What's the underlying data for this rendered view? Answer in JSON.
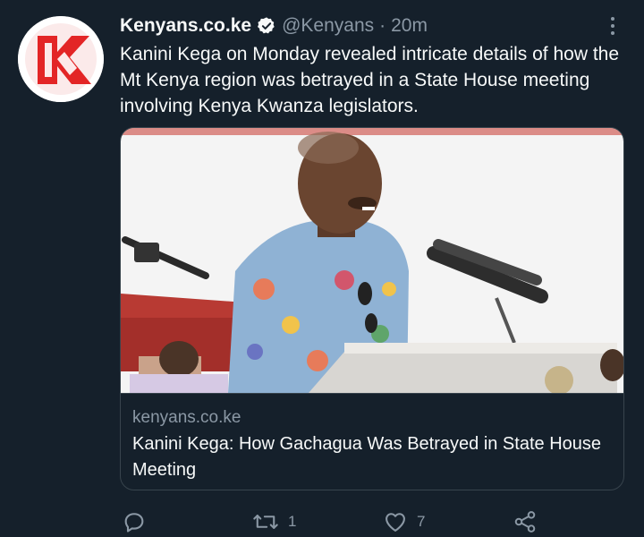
{
  "tweet": {
    "display_name": "Kenyans.co.ke",
    "handle": "@Kenyans",
    "separator": "·",
    "time": "20m",
    "text": "Kanini Kega on Monday revealed intricate details of how the Mt Kenya region was betrayed in a State House meeting involving Kenya Kwanza legislators."
  },
  "card": {
    "domain": "kenyans.co.ke",
    "title": "Kanini Kega: How Gachagua Was Betrayed in State House Meeting"
  },
  "actions": {
    "reply_count": "",
    "retweet_count": "1",
    "like_count": "7"
  },
  "icons": {
    "avatar": "kenyans-k-logo-icon",
    "verified": "verified-badge-icon",
    "more": "more-options-icon",
    "reply": "reply-icon",
    "retweet": "retweet-icon",
    "like": "heart-icon",
    "share": "share-icon"
  },
  "colors": {
    "background": "#15202b",
    "text_primary": "#f7f9f9",
    "text_secondary": "#8b98a5",
    "border": "#38444d",
    "logo_red": "#e32526"
  }
}
